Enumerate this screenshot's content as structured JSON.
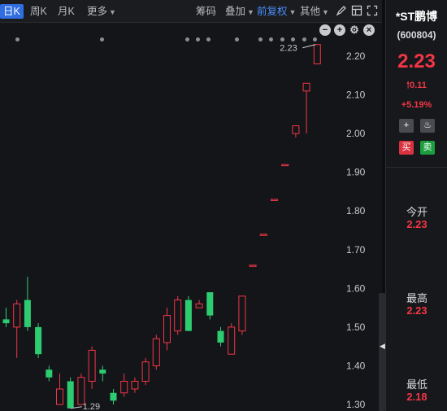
{
  "toolbar": {
    "period_day": "日K",
    "period_week": "周K",
    "period_month": "月K",
    "more": "更多",
    "chips": "筹码",
    "overlay": "叠加",
    "adjust": "前复权",
    "other": "其他"
  },
  "chart_data": {
    "type": "candlestick",
    "y_ticks": [
      "2.20",
      "2.10",
      "2.00",
      "1.90",
      "1.80",
      "1.70",
      "1.60",
      "1.50",
      "1.40",
      "1.30"
    ],
    "ylim": [
      1.29,
      2.25
    ],
    "high_annotation": "2.23",
    "low_annotation": "1.29",
    "candles": [
      {
        "o": 1.52,
        "c": 1.51,
        "h": 1.55,
        "l": 1.5
      },
      {
        "o": 1.5,
        "c": 1.56,
        "h": 1.57,
        "l": 1.42
      },
      {
        "o": 1.57,
        "c": 1.5,
        "h": 1.63,
        "l": 1.49
      },
      {
        "o": 1.5,
        "c": 1.43,
        "h": 1.51,
        "l": 1.42
      },
      {
        "o": 1.39,
        "c": 1.37,
        "h": 1.4,
        "l": 1.36
      },
      {
        "o": 1.3,
        "c": 1.34,
        "h": 1.38,
        "l": 1.3
      },
      {
        "o": 1.36,
        "c": 1.29,
        "h": 1.37,
        "l": 1.29
      },
      {
        "o": 1.3,
        "c": 1.37,
        "h": 1.38,
        "l": 1.3
      },
      {
        "o": 1.36,
        "c": 1.44,
        "h": 1.45,
        "l": 1.34
      },
      {
        "o": 1.39,
        "c": 1.38,
        "h": 1.4,
        "l": 1.36
      },
      {
        "o": 1.33,
        "c": 1.31,
        "h": 1.34,
        "l": 1.3
      },
      {
        "o": 1.33,
        "c": 1.36,
        "h": 1.38,
        "l": 1.32
      },
      {
        "o": 1.34,
        "c": 1.36,
        "h": 1.37,
        "l": 1.33
      },
      {
        "o": 1.36,
        "c": 1.41,
        "h": 1.42,
        "l": 1.35
      },
      {
        "o": 1.4,
        "c": 1.47,
        "h": 1.48,
        "l": 1.39
      },
      {
        "o": 1.46,
        "c": 1.53,
        "h": 1.55,
        "l": 1.44
      },
      {
        "o": 1.49,
        "c": 1.57,
        "h": 1.58,
        "l": 1.48
      },
      {
        "o": 1.57,
        "c": 1.49,
        "h": 1.58,
        "l": 1.49
      },
      {
        "o": 1.55,
        "c": 1.56,
        "h": 1.57,
        "l": 1.55
      },
      {
        "o": 1.59,
        "c": 1.53,
        "h": 1.59,
        "l": 1.52
      },
      {
        "o": 1.49,
        "c": 1.46,
        "h": 1.5,
        "l": 1.45
      },
      {
        "o": 1.43,
        "c": 1.5,
        "h": 1.51,
        "l": 1.43
      },
      {
        "o": 1.49,
        "c": 1.58,
        "h": 1.58,
        "l": 1.48
      },
      {
        "o": 1.66,
        "c": 1.66,
        "h": 1.66,
        "l": 1.66
      },
      {
        "o": 1.74,
        "c": 1.74,
        "h": 1.74,
        "l": 1.74
      },
      {
        "o": 1.83,
        "c": 1.83,
        "h": 1.83,
        "l": 1.83
      },
      {
        "o": 1.92,
        "c": 1.92,
        "h": 1.92,
        "l": 1.92
      },
      {
        "o": 2.0,
        "c": 2.02,
        "h": 2.02,
        "l": 1.99
      },
      {
        "o": 2.11,
        "c": 2.13,
        "h": 2.13,
        "l": 2.0
      },
      {
        "o": 2.18,
        "c": 2.23,
        "h": 2.23,
        "l": 2.18
      }
    ]
  },
  "sidebar": {
    "name": "*ST鹏博",
    "code": "(600804)",
    "price": "2.23",
    "change": "0.11",
    "change_pct": "+5.19%",
    "buy": "买",
    "sell": "卖",
    "open_label": "今开",
    "open_value": "2.23",
    "high_label": "最高",
    "high_value": "2.23",
    "low_label": "最低",
    "low_value": "2.18"
  },
  "colors": {
    "up": "#f23645",
    "down": "#2ecc71",
    "accent": "#2f6de1"
  }
}
